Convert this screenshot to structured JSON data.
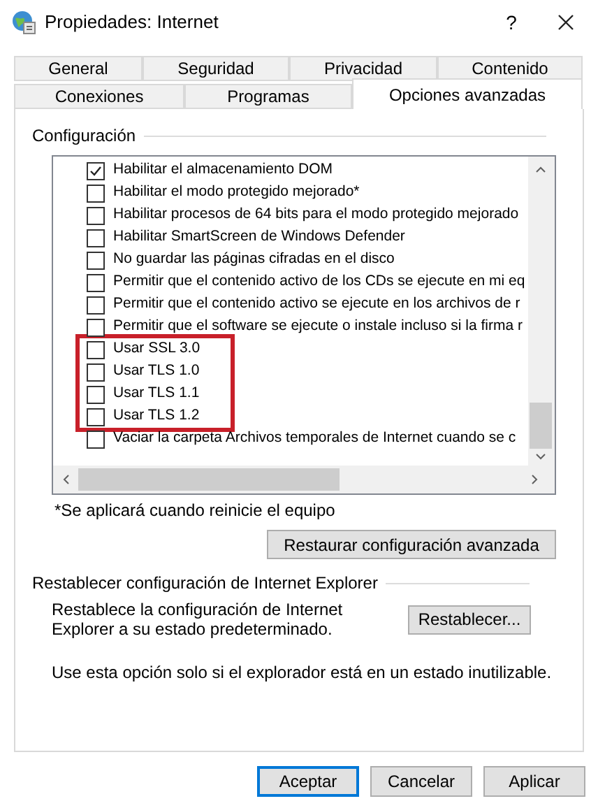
{
  "window": {
    "title": "Propiedades: Internet",
    "help": "?"
  },
  "tab_rows": [
    [
      {
        "label": "General",
        "selected": false
      },
      {
        "label": "Seguridad",
        "selected": false
      },
      {
        "label": "Privacidad",
        "selected": false
      },
      {
        "label": "Contenido",
        "selected": false
      }
    ],
    [
      {
        "label": "Conexiones",
        "selected": false
      },
      {
        "label": "Programas",
        "selected": false
      },
      {
        "label": "Opciones avanzadas",
        "selected": true
      }
    ]
  ],
  "settings": {
    "title": "Configuración",
    "items": [
      {
        "label": "Habilitar el almacenamiento DOM",
        "checked": true,
        "highlighted": false
      },
      {
        "label": "Habilitar el modo protegido mejorado*",
        "checked": false,
        "highlighted": false
      },
      {
        "label": "Habilitar procesos de 64 bits para el modo protegido mejorado",
        "checked": false,
        "highlighted": false
      },
      {
        "label": "Habilitar SmartScreen de Windows Defender",
        "checked": false,
        "highlighted": false
      },
      {
        "label": "No guardar las páginas cifradas en el disco",
        "checked": false,
        "highlighted": false
      },
      {
        "label": "Permitir que el contenido activo de los CDs se ejecute en mi eq",
        "checked": false,
        "highlighted": false
      },
      {
        "label": "Permitir que el contenido activo se ejecute en los archivos de r",
        "checked": false,
        "highlighted": false
      },
      {
        "label": "Permitir que el software se ejecute o instale incluso si la firma r",
        "checked": false,
        "highlighted": false
      },
      {
        "label": "Usar SSL 3.0",
        "checked": false,
        "highlighted": true
      },
      {
        "label": "Usar TLS 1.0",
        "checked": false,
        "highlighted": true
      },
      {
        "label": "Usar TLS 1.1",
        "checked": false,
        "highlighted": true
      },
      {
        "label": "Usar TLS 1.2",
        "checked": false,
        "highlighted": true
      },
      {
        "label": "Vaciar la carpeta Archivos temporales de Internet cuando se c",
        "checked": false,
        "highlighted": false
      }
    ],
    "footnote": "*Se aplicará cuando reinicie el equipo",
    "restore_button": "Restaurar configuración avanzada"
  },
  "reset": {
    "title": "Restablecer configuración de Internet Explorer",
    "description": "Restablece la configuración de Internet Explorer a su estado predeterminado.",
    "button": "Restablecer...",
    "note": "Use esta opción solo si el explorador está en un estado inutilizable."
  },
  "buttons": [
    {
      "label": "Aceptar",
      "default": true
    },
    {
      "label": "Cancelar",
      "default": false
    },
    {
      "label": "Aplicar",
      "default": false
    }
  ]
}
